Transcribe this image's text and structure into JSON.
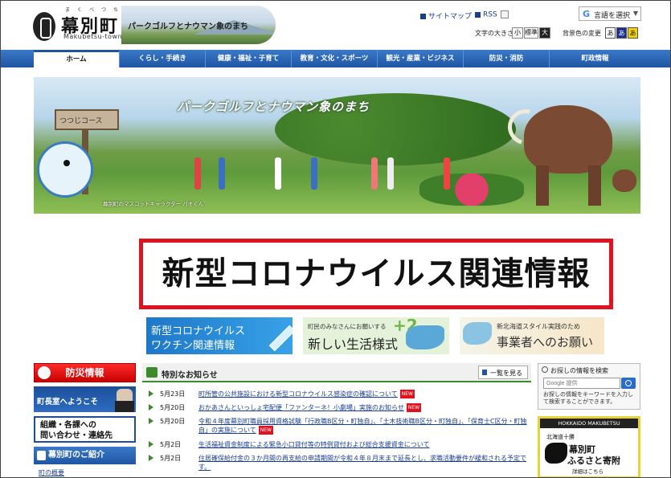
{
  "header": {
    "town_name": "幕別町",
    "town_ruby": "まくべつちょう",
    "town_roman": "Makubetsu-town",
    "banner_text": "パークゴルフとナウマン象のまち",
    "sitemap": "サイトマップ",
    "rss": "RSS",
    "translate": "言語を選択",
    "font_size_label": "文字の大きさ",
    "font_size_small": "小",
    "font_size_standard": "標準",
    "font_size_large": "大",
    "bg_color_label": "背景色の変更",
    "bg_color_buttons": [
      "あ",
      "あ",
      "あ"
    ]
  },
  "nav": {
    "items": [
      "ホーム",
      "くらし・手続き",
      "健康・福祉・子育て",
      "教育・文化・スポーツ",
      "観光・産業・ビジネス",
      "防災・消防",
      "町政情報"
    ]
  },
  "hero": {
    "catchphrase": "パークゴルフとナウマン象のまち",
    "sign_text": "つつじコース",
    "caption": "幕別町のマスコットキャラクター パオくん"
  },
  "corona_banner": "新型コロナウイルス関連情報",
  "banners": {
    "vaccine_line1": "新型コロナウイルス",
    "vaccine_line2": "ワクチン関連情報",
    "lifestyle_line1": "町民のみなさんにお願いする",
    "lifestyle_line2": "新しい生活様式",
    "lifestyle_plus": "+2",
    "business_line1": "新北海道スタイル実践のため",
    "business_line2": "事業者へのお願い"
  },
  "left": {
    "bousai": "防災情報",
    "mayor": "町長室へようこそ",
    "contact_line1": "組織・各課への",
    "contact_line2": "問い合わせ・連絡先",
    "intro": "幕別町のご紹介",
    "intro_link": "町の概要"
  },
  "news": {
    "title": "特別なお知らせ",
    "all_button": "一覧を見る",
    "new_badge": "NEW",
    "items": [
      {
        "date": "5月23日",
        "title": "町所管の公共施設における新型コロナウイルス感染症の確認について",
        "new": true
      },
      {
        "date": "5月20日",
        "title": "おかあさんといっしょ宅配便「ファンターネ！小劇場」実施のお知らせ",
        "new": true
      },
      {
        "date": "5月20日",
        "title": "令和４年度幕別町職員採用資格試験「行政職B区分・町独自」、「土木技術職B区分・町独自」、「保育士C区分・町独自」の実施について",
        "new": true
      },
      {
        "date": "5月2日",
        "title": "生活福祉資金制度による緊急小口貸付等の特例貸付および総合支援資金について",
        "new": false
      },
      {
        "date": "5月2日",
        "title": "住居確保給付金の３か月間の再支給の申請期間が令和４年８月末まで延長とし、求職活動要件が緩和される予定です。",
        "new": false
      }
    ]
  },
  "search": {
    "title": "お探しの情報を検索",
    "placeholder": "Google 提供",
    "note": "お探しの情報をキーワードを入力して検索することができます。"
  },
  "furusato": {
    "top": "HOKKAIDO MAKUBETSU",
    "sub": "北海道十勝",
    "line1": "幕別町",
    "line2": "ふるさと寄附",
    "detail": "詳細はこちら"
  }
}
